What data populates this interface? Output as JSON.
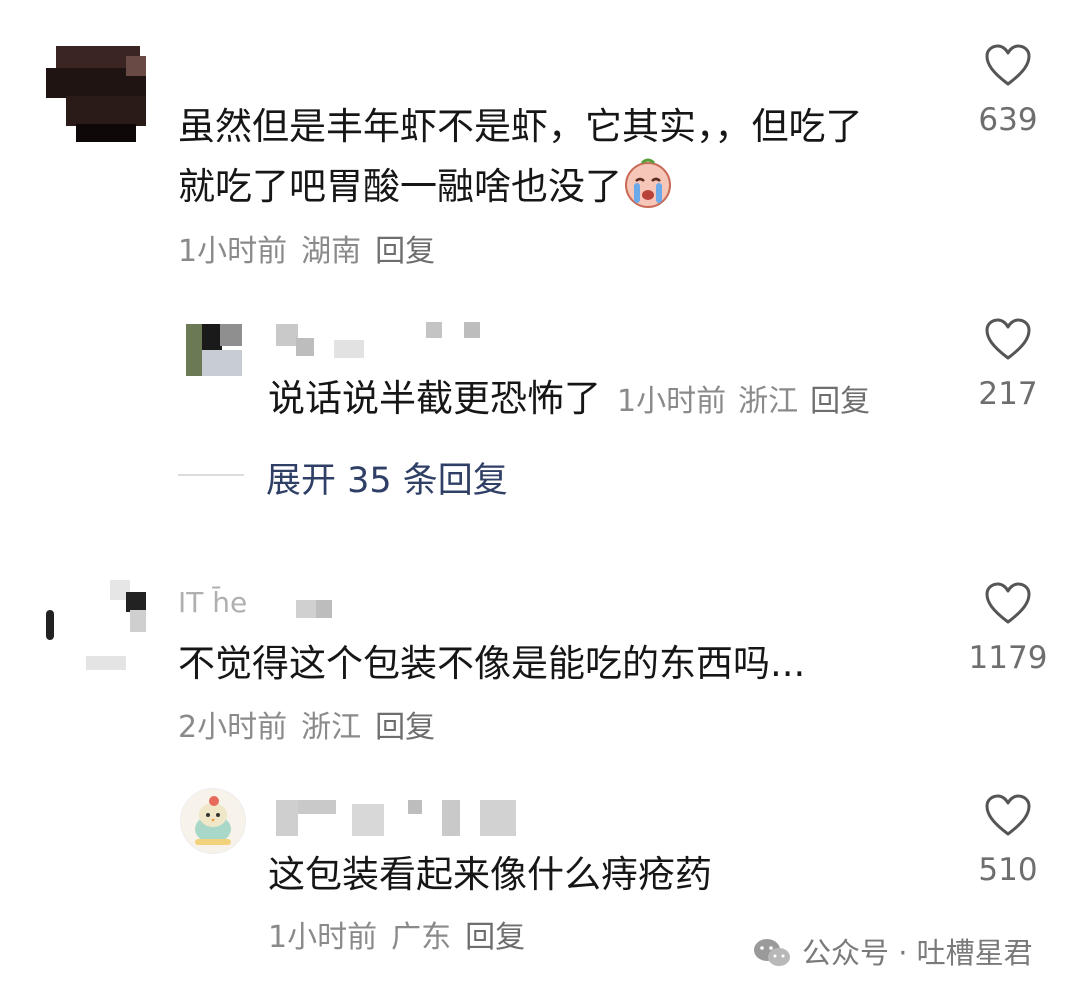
{
  "comments": [
    {
      "text_line1": "虽然但是丰年虾不是虾，它其实，，但吃了",
      "text_line2": "就吃了吧胃酸一融啥也没了",
      "emoji": "crying-face-emoji",
      "time": "1小时前",
      "location": "湖南",
      "reply_label": "回复",
      "likes": "639",
      "replies": [
        {
          "text": "说话说半截更恐怖了",
          "time": "1小时前",
          "location": "浙江",
          "reply_label": "回复",
          "likes": "217"
        }
      ],
      "expand_label": "展开 35 条回复"
    },
    {
      "username": "IT h̄e",
      "text": "不觉得这个包装不像是能吃的东西吗...",
      "time": "2小时前",
      "location": "浙江",
      "reply_label": "回复",
      "likes": "1179",
      "replies": [
        {
          "text": "这包装看起来像什么痔疮药",
          "time": "1小时前",
          "location": "广东",
          "reply_label": "回复",
          "likes": "510"
        }
      ]
    }
  ],
  "watermark": {
    "icon": "wechat-icon",
    "text": "公众号 · 吐槽星君"
  },
  "colors": {
    "text": "#161616",
    "meta": "#8a8a8a",
    "expand": "#2f3f66"
  }
}
